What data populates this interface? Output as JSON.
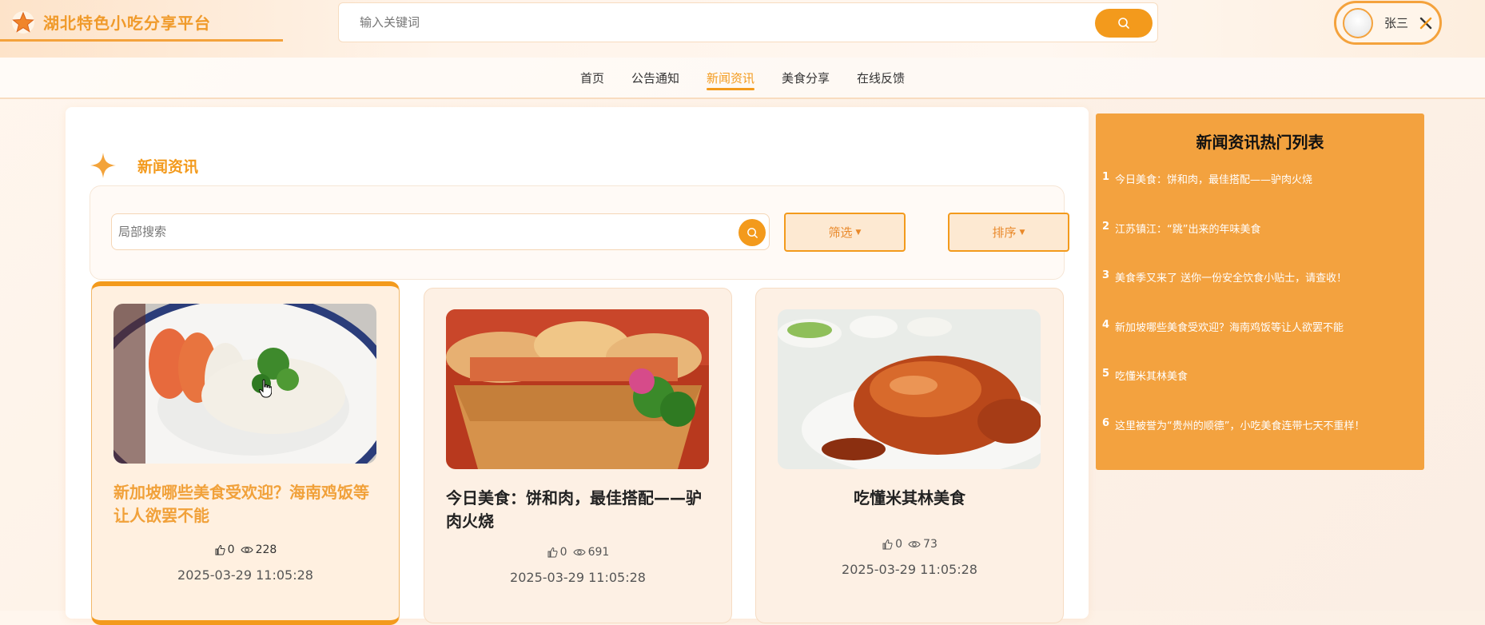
{
  "header": {
    "brand_title": "湖北特色小吃分享平台",
    "search_placeholder": "输入关键词",
    "user_name": "张三"
  },
  "nav": {
    "items": [
      {
        "label": "首页"
      },
      {
        "label": "公告通知"
      },
      {
        "label": "新闻资讯"
      },
      {
        "label": "美食分享"
      },
      {
        "label": "在线反馈"
      }
    ],
    "active_index": 2
  },
  "section": {
    "title": "新闻资讯",
    "local_search_placeholder": "局部搜索",
    "filter_label": "筛选",
    "sort_label": "排序"
  },
  "cards": [
    {
      "title": "新加坡哪些美食受欢迎？海南鸡饭等让人欲罢不能",
      "likes": "0",
      "views": "228",
      "date": "2025-03-29 11:05:28"
    },
    {
      "title": "今日美食：饼和肉，最佳搭配——驴肉火烧",
      "likes": "0",
      "views": "691",
      "date": "2025-03-29 11:05:28"
    },
    {
      "title": "吃懂米其林美食",
      "likes": "0",
      "views": "73",
      "date": "2025-03-29 11:05:28"
    }
  ],
  "hot_list": {
    "title": "新闻资讯热门列表",
    "items": [
      {
        "index": "1",
        "text": "今日美食：饼和肉，最佳搭配——驴肉火烧"
      },
      {
        "index": "2",
        "text": "江苏镇江：“跳”出来的年味美食"
      },
      {
        "index": "3",
        "text": "美食季又来了 送你一份安全饮食小贴士，请查收！"
      },
      {
        "index": "4",
        "text": "新加坡哪些美食受欢迎？海南鸡饭等让人欲罢不能"
      },
      {
        "index": "5",
        "text": "吃懂米其林美食"
      },
      {
        "index": "6",
        "text": "这里被誉为“贵州的顺德”，小吃美食连带七天不重样！"
      }
    ]
  },
  "colors": {
    "accent": "#f39a1c",
    "panel": "#f3a23f",
    "card_bg": "#fdf0e4"
  }
}
